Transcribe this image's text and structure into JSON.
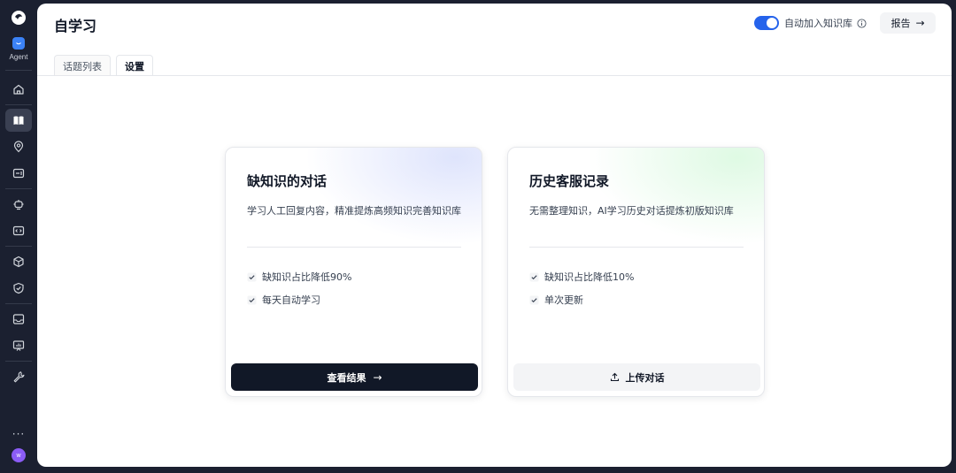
{
  "sidebar": {
    "agent_label": "Agent",
    "avatar_initial": "w",
    "more_label": "···",
    "accent_color": "#3b82f6",
    "avatar_color": "#8b5cf6",
    "nav_items": [
      {
        "icon": "home-icon",
        "active": false
      },
      {
        "icon": "book-icon",
        "active": true
      },
      {
        "icon": "location-pin-icon",
        "active": false
      },
      {
        "icon": "ticket-icon",
        "active": false
      },
      {
        "icon": "robot-icon",
        "active": false
      },
      {
        "icon": "code-icon",
        "active": false
      },
      {
        "icon": "cube-icon",
        "active": false
      },
      {
        "icon": "shield-check-icon",
        "active": false
      },
      {
        "icon": "inbox-icon",
        "active": false
      },
      {
        "icon": "presentation-chart-icon",
        "active": false
      },
      {
        "icon": "wrench-icon",
        "active": false
      }
    ]
  },
  "header": {
    "title": "自学习",
    "toggle_label": "自动加入知识库",
    "toggle_on": true,
    "report_label": "报告",
    "report_arrow": "→"
  },
  "tabs": [
    {
      "label": "话题列表",
      "active": false
    },
    {
      "label": "设置",
      "active": true
    }
  ],
  "cards": [
    {
      "title": "缺知识的对话",
      "description": "学习人工回复内容，精准提炼高频知识完善知识库",
      "features": [
        "缺知识占比降低90%",
        "每天自动学习"
      ],
      "button_label": "查看结果",
      "button_arrow": "→"
    },
    {
      "title": "历史客服记录",
      "description": "无需整理知识，AI学习历史对话提炼初版知识库",
      "features": [
        "缺知识占比降低10%",
        "单次更新"
      ],
      "button_label": "上传对话"
    }
  ]
}
